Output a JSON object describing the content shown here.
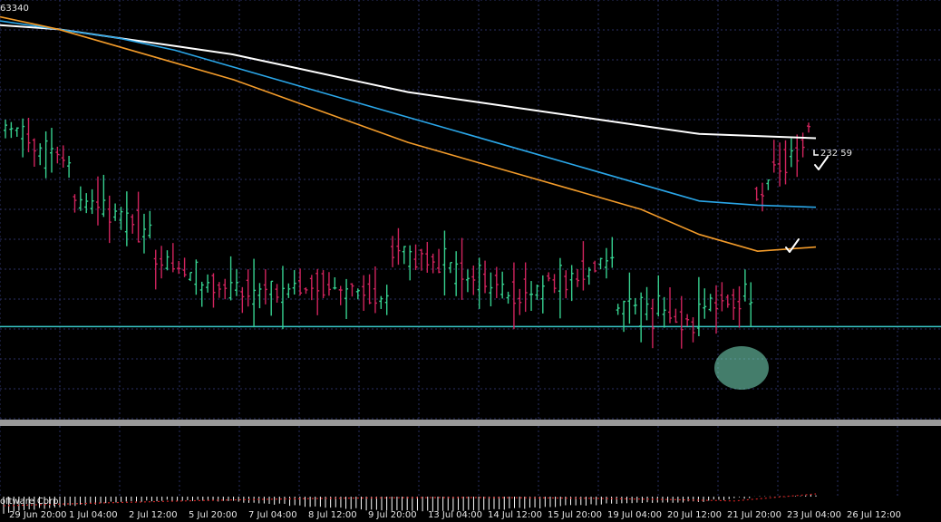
{
  "header": {
    "left_value": "63340"
  },
  "footer": {
    "copyright": "oftware Corp."
  },
  "price_marker": {
    "label": "232 59",
    "color": "#cc00cc"
  },
  "colors": {
    "background": "#000000",
    "grid": "#2a2f63",
    "bull": "#36d08f",
    "bear": "#d0245d",
    "ma_white": "#ffffff",
    "ma_blue": "#2aa6e8",
    "ma_orange": "#f29b2a",
    "support": "#38c6c6",
    "highlight": "#7be3c2",
    "separator": "#9a9a9a",
    "macd_bar": "#ffffff",
    "signal": "#cc2222",
    "tick_text": "#e6e6e6"
  },
  "chart_data": {
    "type": "line",
    "x_tick_labels": [
      "29 Jun 20:00",
      "1 Jul 04:00",
      "2 Jul 12:00",
      "5 Jul 20:00",
      "7 Jul 04:00",
      "8 Jul 12:00",
      "9 Jul 20:00",
      "13 Jul 04:00",
      "14 Jul 12:00",
      "15 Jul 20:00",
      "19 Jul 04:00",
      "20 Jul 12:00",
      "21 Jul 20:00",
      "23 Jul 04:00",
      "26 Jul 12:00"
    ],
    "series": [
      {
        "name": "",
        "role": "ma_white",
        "values": [
          94,
          93,
          91,
          89,
          87,
          84,
          81,
          78,
          76,
          74,
          72,
          70,
          68,
          67.5,
          67
        ]
      },
      {
        "name": "",
        "role": "ma_blue",
        "values": [
          95,
          93,
          91,
          88,
          84,
          80,
          76,
          72,
          68,
          64,
          60,
          56,
          52,
          51,
          50.5
        ]
      },
      {
        "name": "",
        "role": "ma_orange",
        "values": [
          96,
          93,
          89,
          85,
          81,
          76,
          71,
          66,
          62,
          58,
          54,
          50,
          44,
          40,
          41
        ]
      }
    ],
    "support_level": 22,
    "ylim": [
      0,
      100
    ],
    "grid": true
  }
}
